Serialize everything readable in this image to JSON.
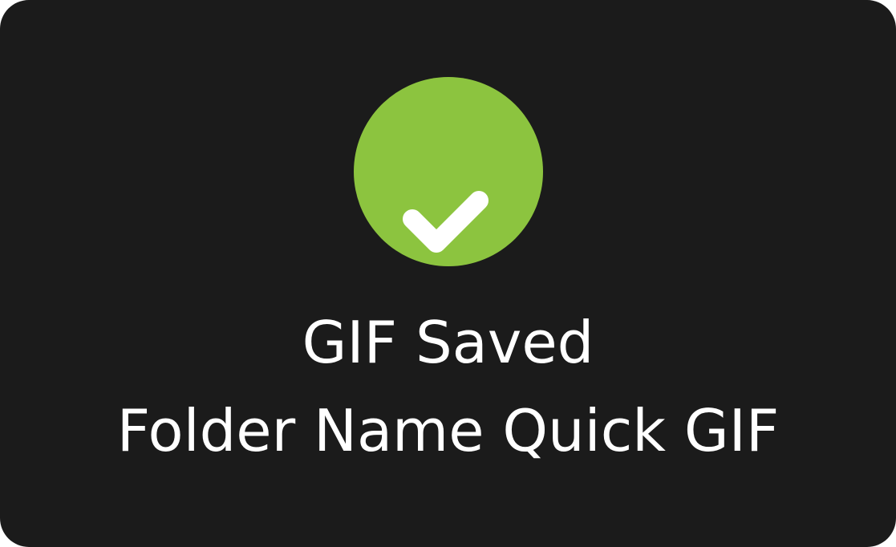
{
  "toast": {
    "status_icon": "checkmark-circle-icon",
    "title": "GIF Saved",
    "subtitle": "Folder Name Quick GIF",
    "colors": {
      "background": "#1b1b1b",
      "success": "#8cc43f",
      "text": "#ffffff"
    }
  }
}
